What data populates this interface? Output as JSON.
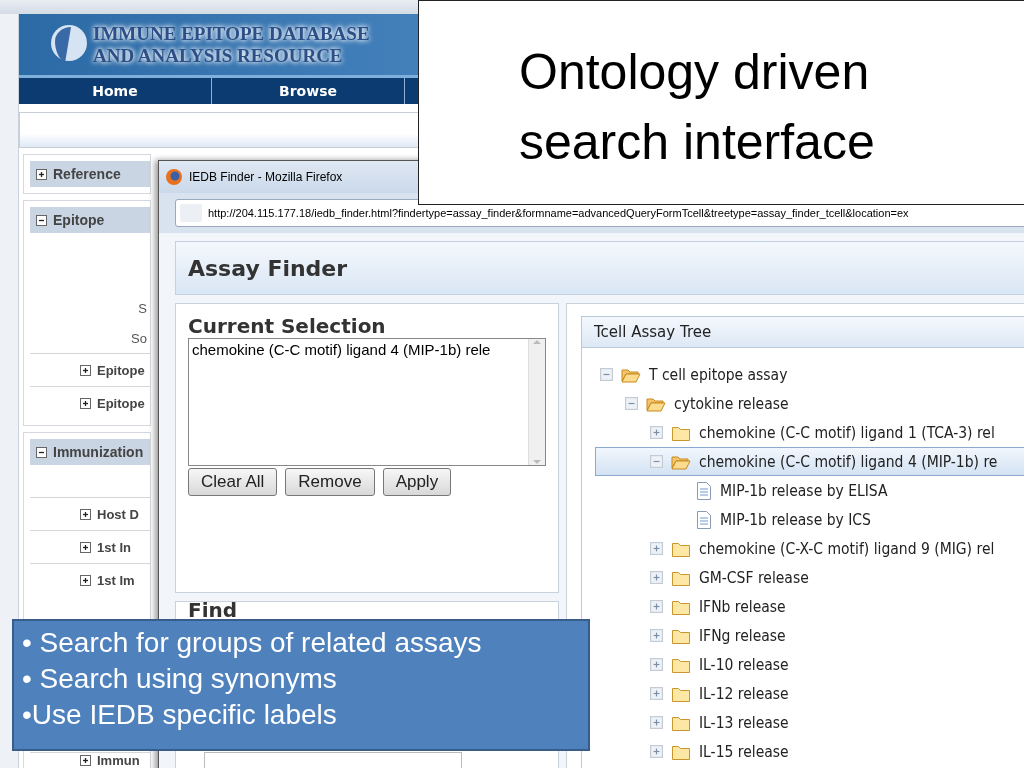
{
  "background_page": {
    "logo_lines": [
      "IMMUNE EPITOPE DATABASE",
      "AND ANALYSIS RESOURCE"
    ],
    "nav": [
      {
        "label": "Home"
      },
      {
        "label": "Browse"
      }
    ],
    "sidebar": [
      {
        "title": "Reference",
        "expanded": false
      },
      {
        "title": "Epitope",
        "expanded": true,
        "rows": [
          {
            "kind": "field",
            "label": "S"
          },
          {
            "kind": "field",
            "label": "So"
          },
          {
            "kind": "group",
            "label": "Epitope",
            "expanded": false
          },
          {
            "kind": "group",
            "label": "Epitope",
            "expanded": false
          }
        ]
      },
      {
        "title": "Immunization",
        "expanded": true,
        "rows": [
          {
            "kind": "group",
            "label": "Host D",
            "expanded": false
          },
          {
            "kind": "group",
            "label": "1st In",
            "expanded": false
          },
          {
            "kind": "group",
            "label": "1st Im",
            "expanded": false
          },
          {
            "kind": "group",
            "label": "Immun",
            "expanded": false
          }
        ]
      }
    ]
  },
  "popup": {
    "title": "IEDB Finder - Mozilla Firefox",
    "url": "http://204.115.177.18/iedb_finder.html?findertype=assay_finder&formname=advancedQueryFormTcell&treetype=assay_finder_tcell&location=ex",
    "header": "Assay Finder",
    "current_selection": {
      "title": "Current Selection",
      "items": [
        "chemokine (C-C motif) ligand 4 (MIP-1b) rele"
      ],
      "buttons": [
        "Clear All",
        "Remove",
        "Apply"
      ]
    },
    "find": {
      "title": "Find"
    },
    "tree": {
      "title": "Tcell Assay Tree",
      "items": [
        {
          "kind": "folder",
          "label": "T cell epitope assay",
          "expanded": true,
          "selected": false,
          "children": [
            {
              "kind": "folder",
              "label": "cytokine release",
              "expanded": true,
              "selected": false,
              "children": [
                {
                  "kind": "folder",
                  "label": "chemokine (C-C motif) ligand 1 (TCA-3) rel",
                  "expanded": false,
                  "selected": false
                },
                {
                  "kind": "folder",
                  "label": "chemokine (C-C motif) ligand 4 (MIP-1b) re",
                  "expanded": true,
                  "selected": true,
                  "children": [
                    {
                      "kind": "leaf",
                      "label": "MIP-1b release by ELISA",
                      "selected": false
                    },
                    {
                      "kind": "leaf",
                      "label": "MIP-1b release by ICS",
                      "selected": false
                    }
                  ]
                },
                {
                  "kind": "folder",
                  "label": "chemokine (C-X-C motif) ligand 9 (MIG) rel",
                  "expanded": false,
                  "selected": false
                },
                {
                  "kind": "folder",
                  "label": "GM-CSF release",
                  "expanded": false,
                  "selected": false
                },
                {
                  "kind": "folder",
                  "label": "IFNb release",
                  "expanded": false,
                  "selected": false
                },
                {
                  "kind": "folder",
                  "label": "IFNg release",
                  "expanded": false,
                  "selected": false
                },
                {
                  "kind": "folder",
                  "label": "IL-10 release",
                  "expanded": false,
                  "selected": false
                },
                {
                  "kind": "folder",
                  "label": "IL-12 release",
                  "expanded": false,
                  "selected": false
                },
                {
                  "kind": "folder",
                  "label": "IL-13 release",
                  "expanded": false,
                  "selected": false
                },
                {
                  "kind": "folder",
                  "label": "IL-15 release",
                  "expanded": false,
                  "selected": false
                }
              ]
            }
          ]
        }
      ]
    }
  },
  "slide_title": [
    "Ontology driven",
    "search interface"
  ],
  "callout": {
    "bullets": [
      "• Search for groups of related assays",
      "• Search using synonyms",
      "•Use IEDB specific labels"
    ]
  }
}
